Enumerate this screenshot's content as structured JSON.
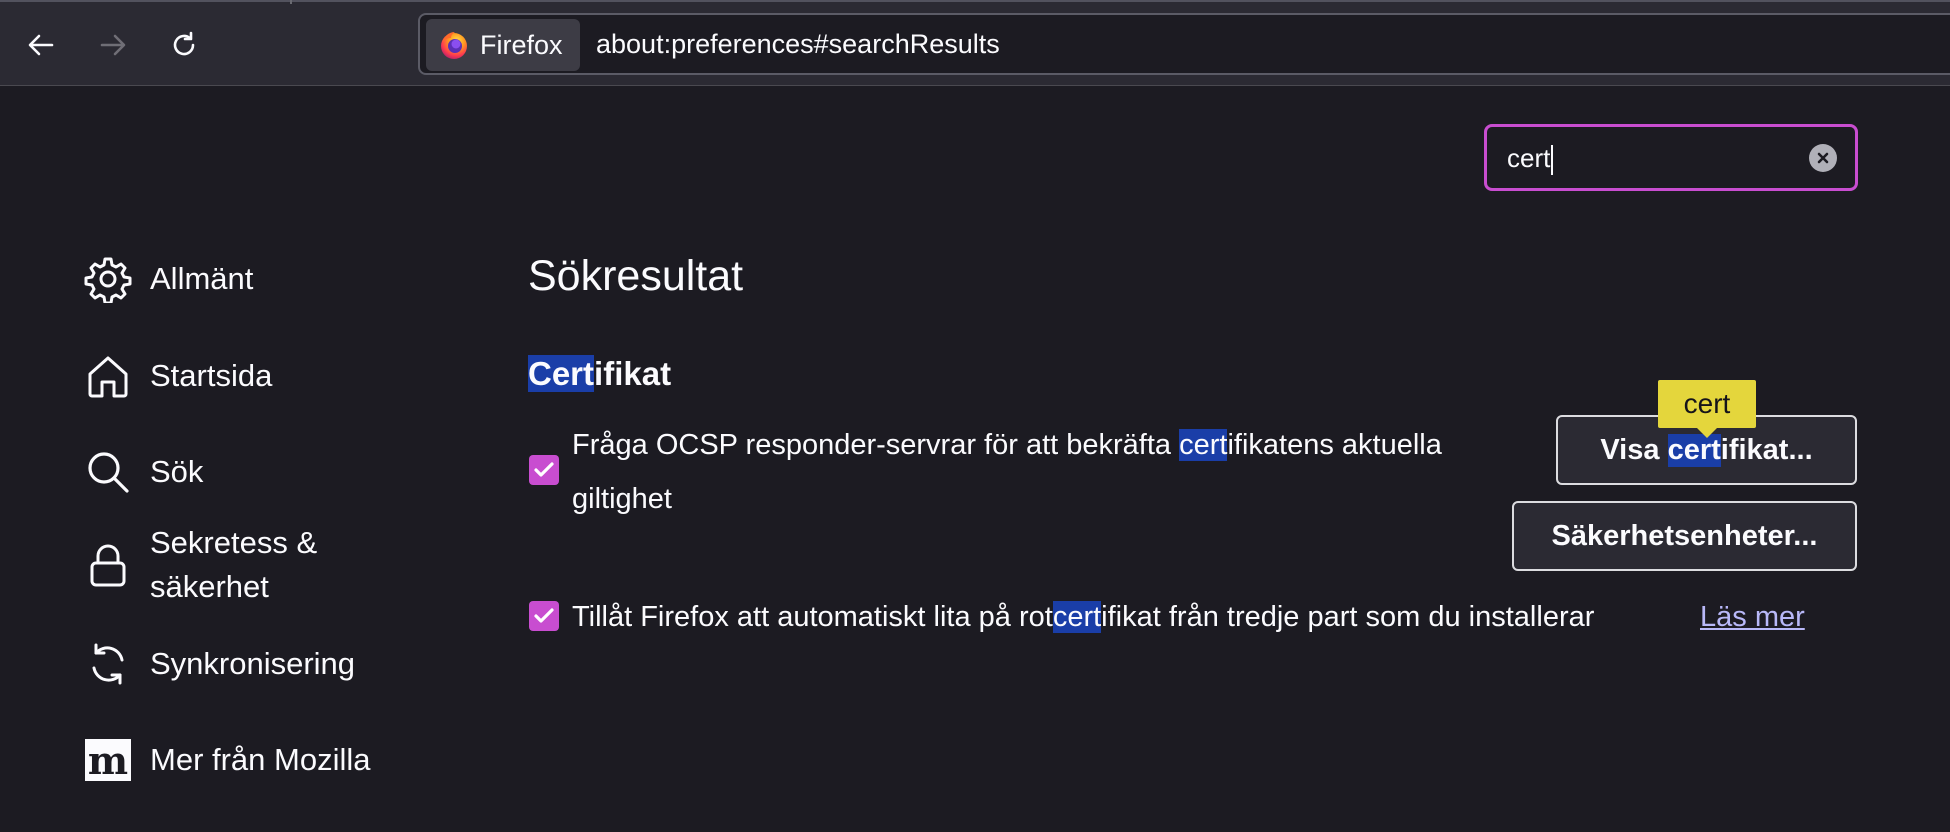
{
  "browser": {
    "identity_label": "Firefox",
    "url": "about:preferences#searchResults"
  },
  "search": {
    "value": "cert"
  },
  "sidebar": {
    "items": [
      {
        "label": "Allmänt",
        "icon": "gear-icon"
      },
      {
        "label": "Startsida",
        "icon": "home-icon"
      },
      {
        "label": "Sök",
        "icon": "search-icon"
      },
      {
        "label_line1": "Sekretess &",
        "label_line2": "säkerhet",
        "icon": "lock-icon"
      },
      {
        "label": "Synkronisering",
        "icon": "sync-icon"
      },
      {
        "label": "Mer från Mozilla",
        "icon": "mozilla-icon"
      }
    ]
  },
  "main": {
    "title": "Sökresultat",
    "section": {
      "title_hl": "Cert",
      "title_rest": "ifikat"
    },
    "ocsp": {
      "checked": true,
      "text_pre": "Fråga OCSP responder-servrar för att bekräfta ",
      "text_hl": "cert",
      "text_post": "ifikatens aktuella",
      "text_line2": "giltighet"
    },
    "view_certs_button": {
      "pre": "Visa ",
      "hl": "cert",
      "post": "ifikat..."
    },
    "security_devices_button": "Säkerhetsenheter...",
    "tooltip": "cert",
    "third_party": {
      "checked": true,
      "text_pre": "Tillåt Firefox att automatiskt lita på rot",
      "text_hl": "cert",
      "text_post": "ifikat från tredje part som du installerar",
      "learn_more": "Läs mer"
    }
  },
  "colors": {
    "background": "#1c1b22",
    "accent": "#c84dd0",
    "highlight": "#1a3ea8",
    "tooltip": "#e4d63c",
    "link": "#b8b8f8"
  }
}
